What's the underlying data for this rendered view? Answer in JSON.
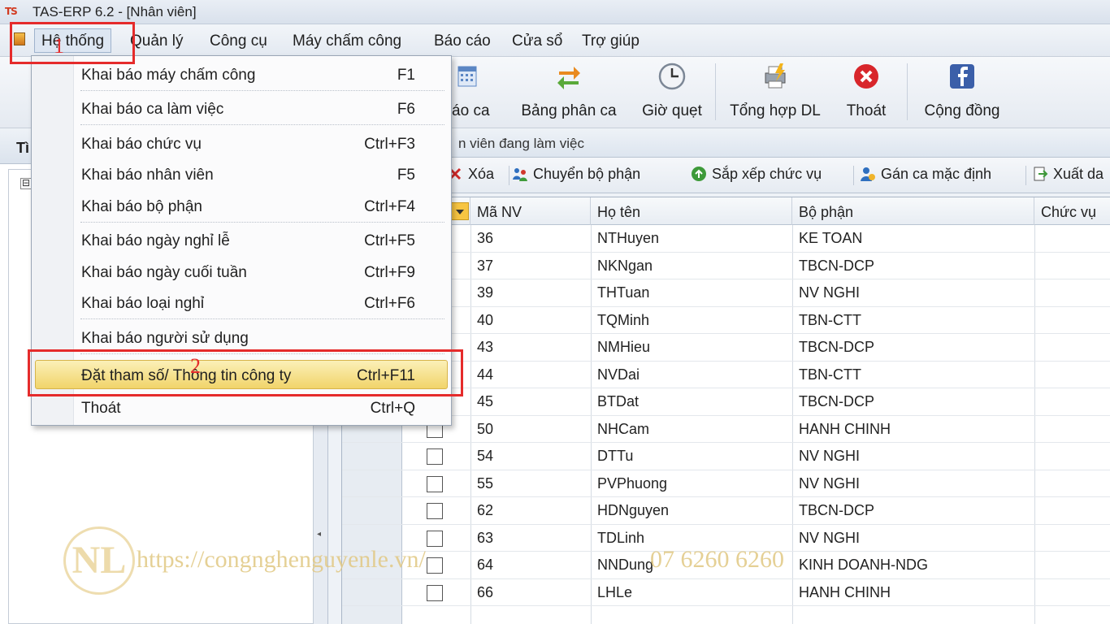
{
  "window": {
    "title": "TAS-ERP 6.2 - [Nhân viên]",
    "logo_text": "TS"
  },
  "menubar": {
    "items": [
      "Hệ thống",
      "Quản lý",
      "Công cụ",
      "Máy chấm công",
      "Báo cáo",
      "Cửa sổ",
      "Trợ giúp"
    ]
  },
  "toolbar": {
    "buttons": [
      {
        "label": "báo ca",
        "icon": "calendar-icon"
      },
      {
        "label": "Bảng phân ca",
        "icon": "swap-arrows-icon"
      },
      {
        "label": "Giờ quẹt",
        "icon": "clock-icon"
      },
      {
        "label": "Tổng hợp DL",
        "icon": "printer-lightning-icon"
      },
      {
        "label": "Thoát",
        "icon": "exit-icon"
      },
      {
        "label": "Cộng đồng",
        "icon": "facebook-icon"
      }
    ]
  },
  "left_panel": {
    "header": "Tì",
    "tree_toggle": "⊟"
  },
  "right_panel": {
    "status": "n viên đang làm việc",
    "grid_toolbar": [
      {
        "label": "Xóa",
        "icon": "delete-icon"
      },
      {
        "label": "Chuyển bộ phận",
        "icon": "transfer-icon"
      },
      {
        "label": "Sắp xếp chức vụ",
        "icon": "sort-icon"
      },
      {
        "label": "Gán ca mặc định",
        "icon": "assign-shift-icon"
      },
      {
        "label": "Xuất da",
        "icon": "export-icon"
      }
    ]
  },
  "grid": {
    "columns": [
      "Mã NV",
      "Họ tên",
      "Bộ phận",
      "Chức vụ"
    ],
    "rows": [
      {
        "id": "36",
        "name": "NTHuyen",
        "dept": "KE TOAN"
      },
      {
        "id": "37",
        "name": "NKNgan",
        "dept": "TBCN-DCP"
      },
      {
        "id": "39",
        "name": "THTuan",
        "dept": "NV NGHI"
      },
      {
        "id": "40",
        "name": "TQMinh",
        "dept": "TBN-CTT"
      },
      {
        "id": "43",
        "name": "NMHieu",
        "dept": "TBCN-DCP"
      },
      {
        "id": "44",
        "name": "NVDai",
        "dept": "TBN-CTT"
      },
      {
        "id": "45",
        "name": "BTDat",
        "dept": "TBCN-DCP"
      },
      {
        "id": "50",
        "name": "NHCam",
        "dept": "HANH CHINH"
      },
      {
        "id": "54",
        "name": "DTTu",
        "dept": "NV NGHI"
      },
      {
        "id": "55",
        "name": "PVPhuong",
        "dept": "NV NGHI"
      },
      {
        "id": "62",
        "name": "HDNguyen",
        "dept": "TBCN-DCP"
      },
      {
        "id": "63",
        "name": "TDLinh",
        "dept": "NV NGHI"
      },
      {
        "id": "64",
        "name": "NNDung",
        "dept": "KINH DOANH-NDG"
      },
      {
        "id": "66",
        "name": "LHLe",
        "dept": "HANH CHINH"
      }
    ]
  },
  "dropdown": {
    "items": [
      {
        "label": "Khai báo máy chấm công",
        "shortcut": "F1"
      },
      {
        "label": "Khai báo ca làm việc",
        "shortcut": "F6"
      },
      {
        "label": "Khai báo chức vụ",
        "shortcut": "Ctrl+F3"
      },
      {
        "label": "Khai báo nhân viên",
        "shortcut": "F5"
      },
      {
        "label": "Khai báo bộ phận",
        "shortcut": "Ctrl+F4"
      },
      {
        "label": "Khai báo ngày nghỉ lễ",
        "shortcut": "Ctrl+F5"
      },
      {
        "label": "Khai báo ngày cuối tuần",
        "shortcut": "Ctrl+F9"
      },
      {
        "label": "Khai báo loại nghỉ",
        "shortcut": "Ctrl+F6"
      },
      {
        "label": "Khai báo người sử dụng",
        "shortcut": ""
      },
      {
        "label": "Đặt tham số/ Thông tin công ty",
        "shortcut": "Ctrl+F11"
      },
      {
        "label": "Thoát",
        "shortcut": "Ctrl+Q"
      }
    ]
  },
  "annotations": {
    "step1": "1",
    "step2": "2"
  },
  "watermark": {
    "logo": "NL",
    "url": "https://congnghenguyenle.vn/",
    "phone": "07 6260 6260"
  },
  "colors": {
    "accent_red": "#e52b2b",
    "highlight": "#f1d46a"
  }
}
